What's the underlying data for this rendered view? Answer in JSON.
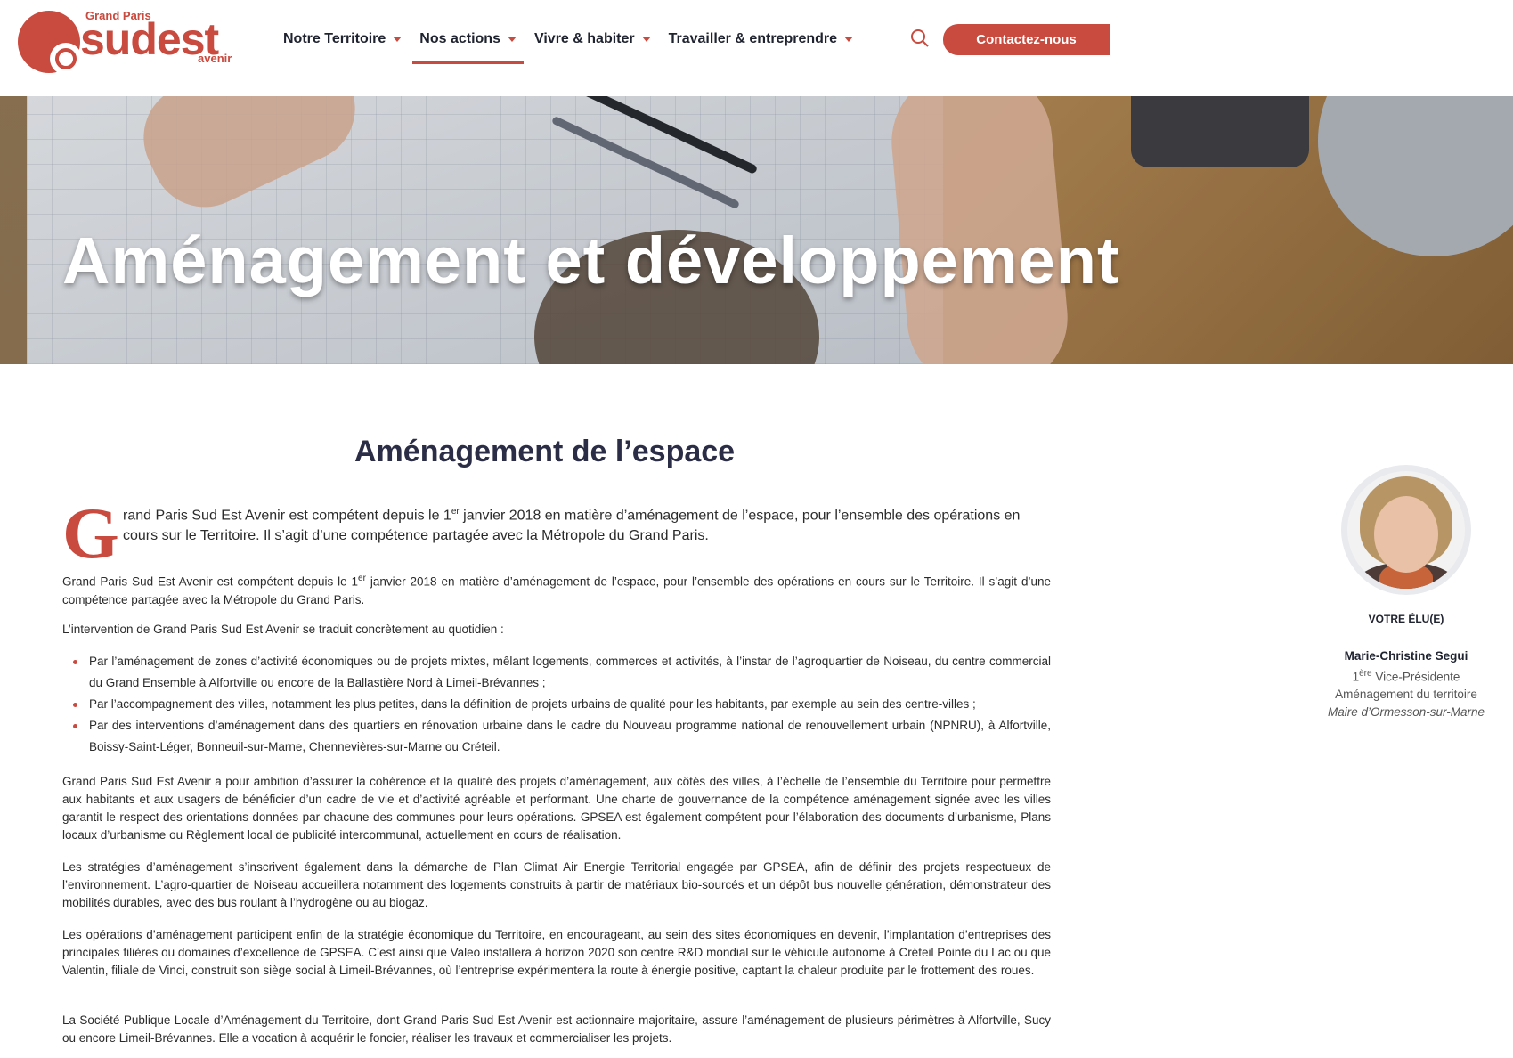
{
  "colors": {
    "accent": "#c94a3e",
    "navy": "#2a2d45"
  },
  "logo": {
    "line1": "Grand Paris",
    "line2": "sudest",
    "line3": "avenir"
  },
  "nav": {
    "items": [
      {
        "label": "Notre Territoire"
      },
      {
        "label": "Nos actions"
      },
      {
        "label": "Vivre & habiter"
      },
      {
        "label": "Travailler & entreprendre"
      }
    ],
    "active": "Nos actions",
    "search_icon": "search-icon",
    "cta_label": "Contactez-nous"
  },
  "hero": {
    "title": "Aménagement et développement"
  },
  "section": {
    "title": "Aménagement de l’espace",
    "dropcap": "G",
    "lead_before": "rand Paris Sud Est Avenir est compétent depuis le 1",
    "lead_sup": "er",
    "lead_after": " janvier 2018 en matière d’aménagement de l’espace, pour l’ensemble des opérations en cours sur le Territoire. Il s’agit d’une compétence partagée avec la Métropole du Grand Paris.",
    "p1_before": "Grand Paris Sud Est Avenir est compétent depuis le 1",
    "p1_sup": "er",
    "p1_after": " janvier 2018 en matière d’aménagement de l’espace, pour l’ensemble des opérations en cours sur le Territoire. Il s’agit d’une compétence partagée avec la Métropole du Grand Paris.",
    "p2": "L’intervention de Grand Paris Sud Est Avenir se traduit concrètement au quotidien :",
    "bullets": [
      "Par l’aménagement de zones d’activité économiques ou de projets mixtes, mêlant logements, commerces et activités, à l’instar de l’agroquartier de Noiseau, du centre commercial du Grand Ensemble à Alfortville ou encore de la Ballastière Nord à Limeil-Brévannes ;",
      "Par l’accompagnement des villes, notamment les plus petites, dans la définition de projets urbains de qualité pour les habitants, par exemple au sein des centre-villes ;",
      "Par des interventions d’aménagement dans des quartiers en rénovation urbaine dans le cadre du Nouveau programme national de renouvellement urbain (NPNRU), à Alfortville, Boissy-Saint-Léger, Bonneuil-sur-Marne, Chennevières-sur-Marne ou Créteil."
    ],
    "p3": "Grand Paris Sud Est Avenir a pour ambition d’assurer la cohérence et la qualité des projets d’aménagement, aux côtés des villes, à l’échelle de l’ensemble du Territoire pour permettre aux habitants et aux usagers de bénéficier d’un cadre de vie et d’activité agréable et performant. Une charte de gouvernance de la compétence aménagement signée avec les villes garantit le respect des orientations données par chacune des communes pour leurs opérations. GPSEA est également compétent pour l’élaboration des documents d’urbanisme, Plans locaux d’urbanisme ou Règlement local de publicité intercommunal, actuellement en cours de réalisation.",
    "p4": "Les stratégies d’aménagement s’inscrivent également dans la démarche de Plan Climat Air Energie Territorial engagée par GPSEA, afin de définir des projets respectueux de l’environnement. L’agro-quartier de Noiseau accueillera notamment des logements construits à partir de matériaux bio-sourcés et un dépôt bus nouvelle génération, démonstrateur des mobilités durables, avec des bus roulant à l’hydrogène ou au biogaz.",
    "p5": "Les opérations d’aménagement participent enfin de la stratégie économique du Territoire, en encourageant, au sein des sites économiques en devenir, l’implantation d’entreprises des principales filières ou domaines d’excellence de GPSEA. C’est ainsi que Valeo installera à horizon 2020 son centre R&D mondial sur le véhicule autonome à Créteil Pointe du Lac ou que Valentin, filiale de Vinci, construit son siège social à Limeil-Brévannes, où l’entreprise expérimentera la route à énergie positive, captant la chaleur produite par le frottement des roues.",
    "p6": "La Société Publique Locale d’Aménagement du Territoire, dont Grand Paris Sud Est Avenir est actionnaire majoritaire, assure l’aménagement de plusieurs périmètres à Alfortville, Sucy ou encore Limeil-Brévannes. Elle a vocation à acquérir le foncier, réaliser les travaux et commercialiser les projets."
  },
  "sidebar": {
    "label": "VOTRE ÉLU(E)",
    "name": "Marie-Christine Segui",
    "title_num": "1",
    "title_sup": "ère",
    "title_rest": " Vice-Présidente",
    "role": "Aménagement du territoire",
    "town": "Maire d’Ormesson-sur-Marne"
  }
}
